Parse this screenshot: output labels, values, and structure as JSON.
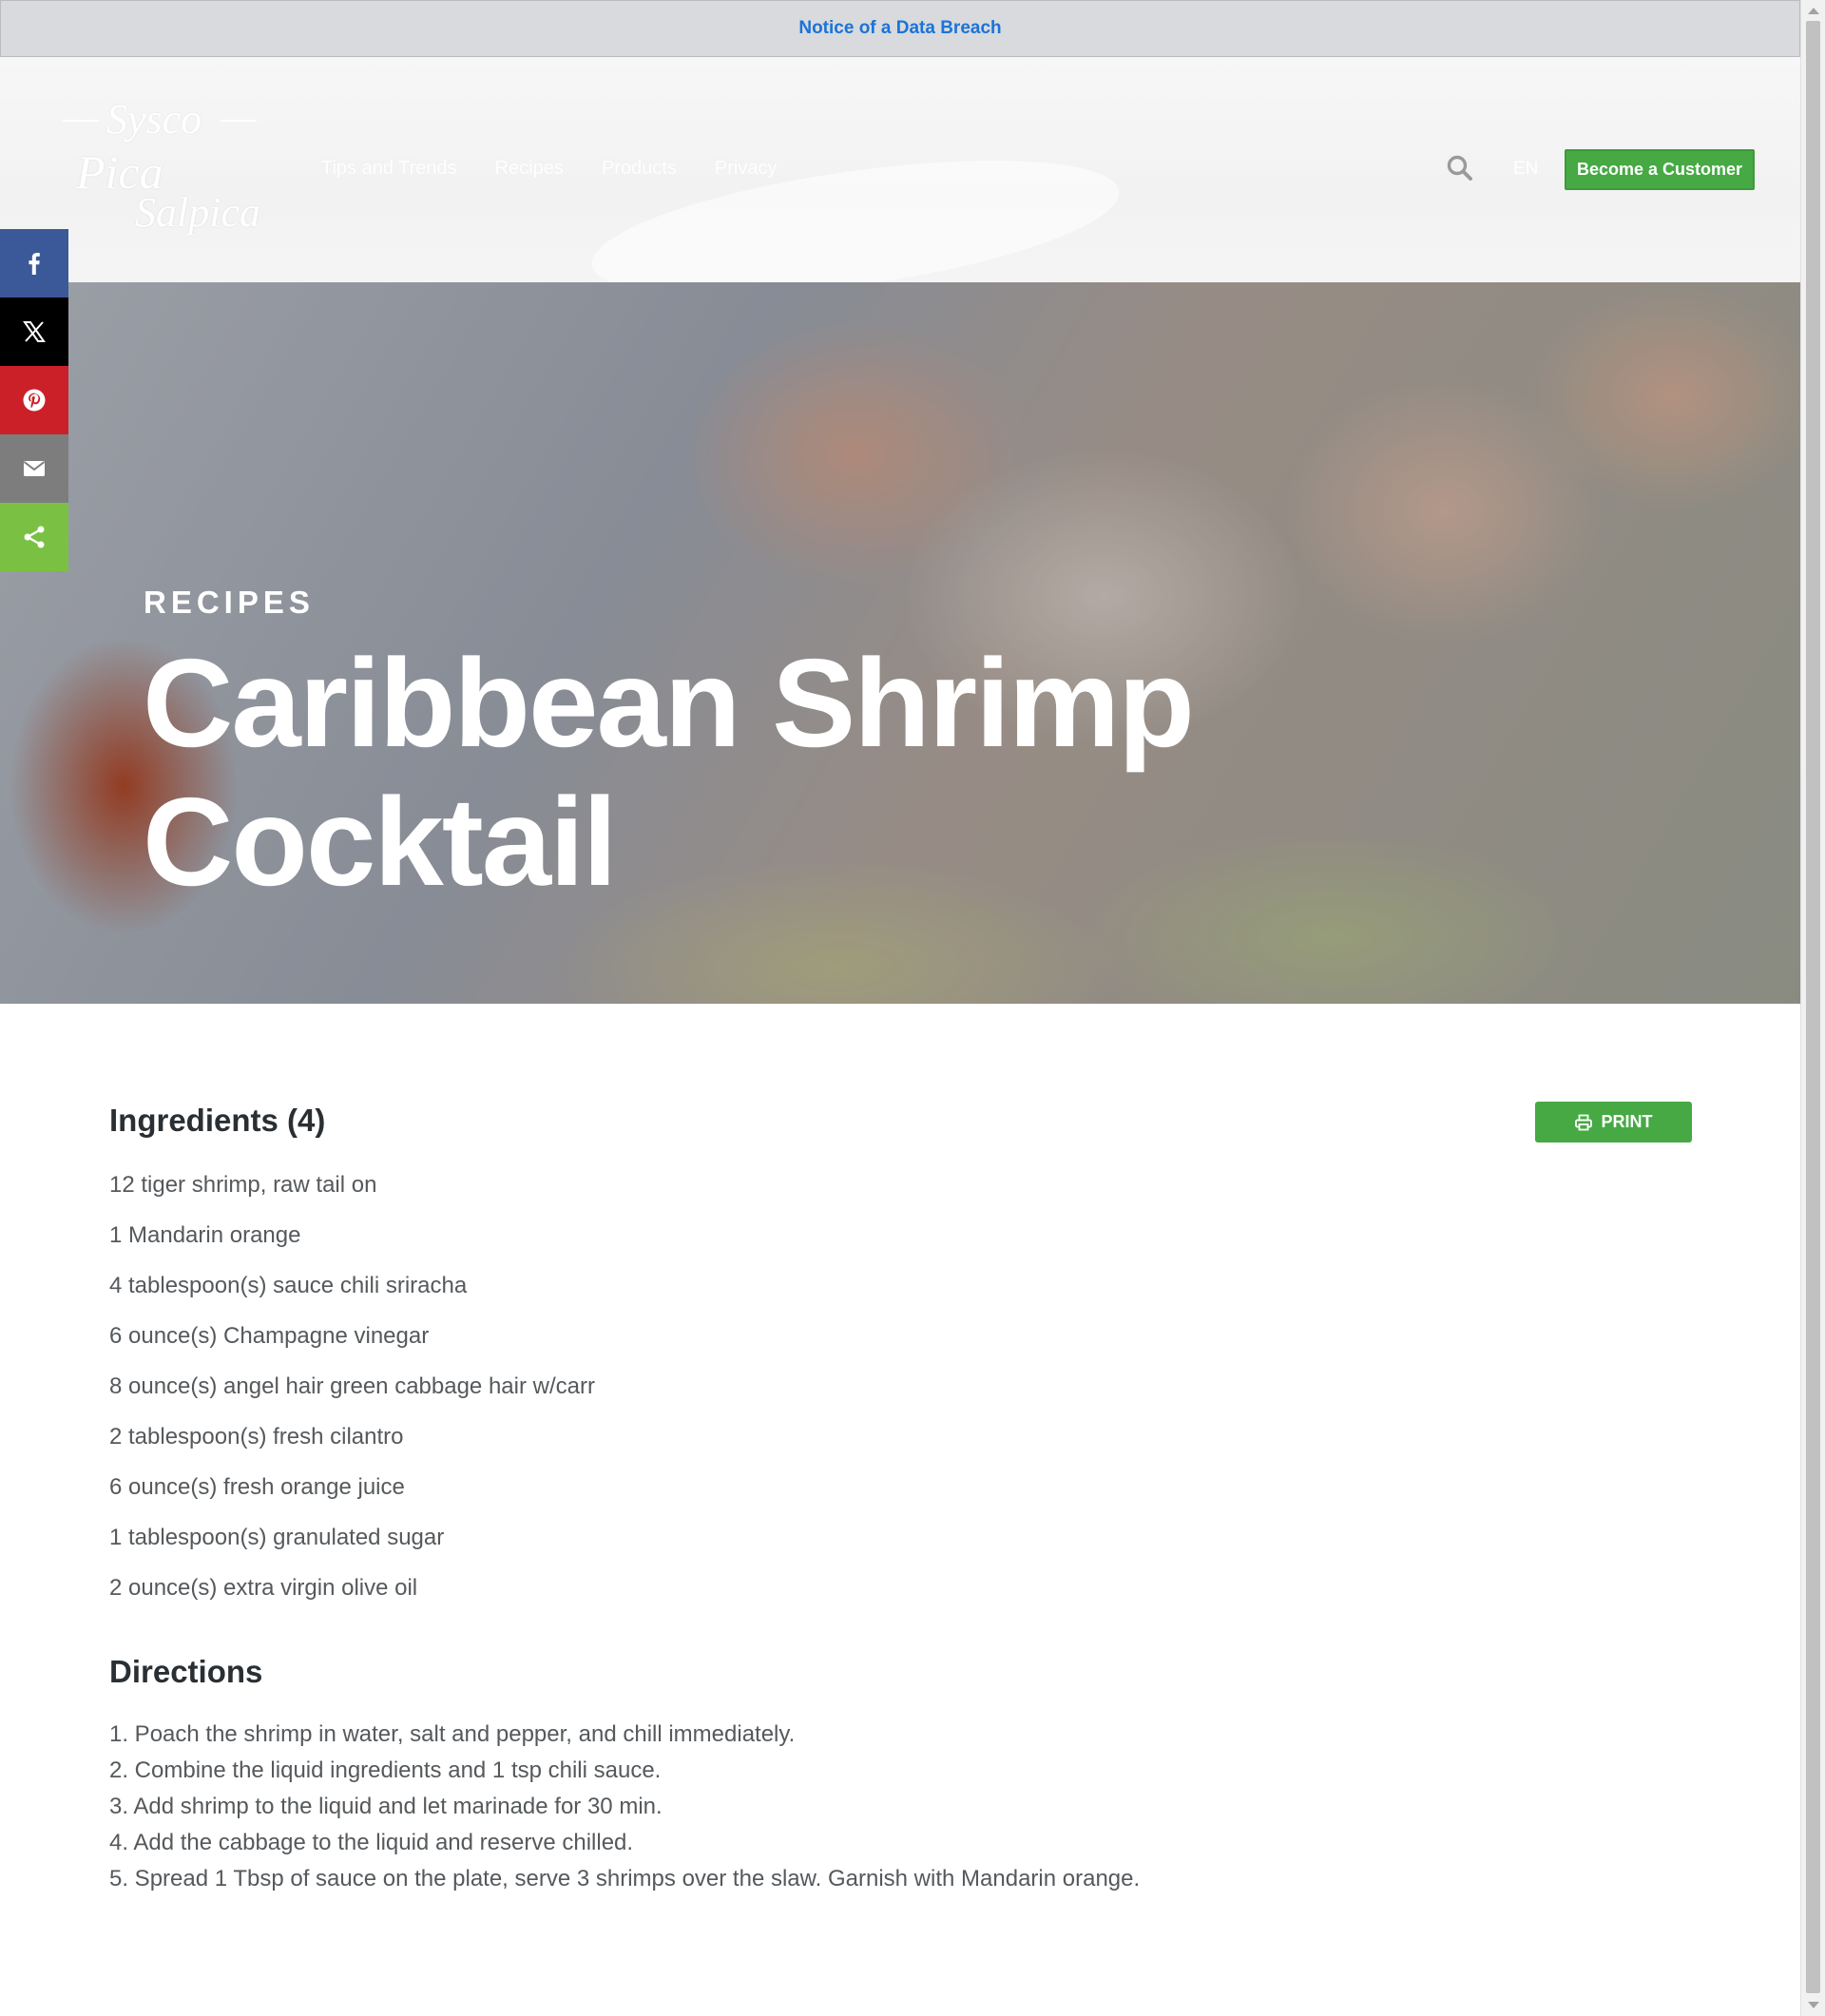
{
  "notice": {
    "link_text": "Notice of a Data Breach"
  },
  "header": {
    "logo": {
      "brand": "Sysco",
      "script_line1": "Pica",
      "script_line2": "Salpica"
    },
    "nav": [
      "Tips and Trends",
      "Recipes",
      "Products",
      "Privacy"
    ],
    "language": "EN",
    "cta_label": "Become a Customer"
  },
  "share": {
    "buttons": [
      "facebook-icon",
      "x-icon",
      "pinterest-icon",
      "email-icon",
      "share-icon"
    ],
    "colors": {
      "facebook": "#3b5998",
      "x": "#000000",
      "pinterest": "#cb2027",
      "email": "#7d7d7d",
      "share": "#7ac143"
    }
  },
  "hero": {
    "kicker": "RECIPES",
    "title": "Caribbean Shrimp Cocktail"
  },
  "recipe": {
    "ingredients_title": "Ingredients (4)",
    "print_label": "PRINT",
    "ingredients": [
      "12 tiger shrimp, raw tail on",
      "1 Mandarin orange",
      "4 tablespoon(s) sauce chili sriracha",
      "6 ounce(s) Champagne vinegar",
      "8 ounce(s) angel hair green cabbage hair w/carr",
      "2 tablespoon(s) fresh cilantro",
      "6 ounce(s) fresh orange juice",
      "1 tablespoon(s) granulated sugar",
      "2 ounce(s) extra virgin olive oil"
    ],
    "directions_title": "Directions",
    "directions": [
      "1. Poach the shrimp in water, salt and pepper, and chill immediately.",
      "2. Combine the liquid ingredients and 1 tsp chili sauce.",
      "3. Add shrimp to the liquid and let marinade for 30 min.",
      "4. Add the cabbage to the liquid and reserve chilled.",
      "5. Spread 1 Tbsp of sauce on the plate, serve 3 shrimps over the slaw. Garnish with Mandarin orange."
    ]
  },
  "theme": {
    "accent_green": "#46a943",
    "link_blue": "#1a73d9"
  }
}
